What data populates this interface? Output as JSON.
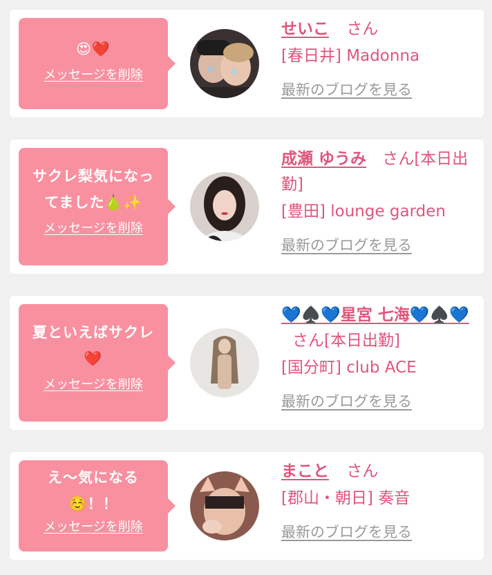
{
  "colors": {
    "background": "#f0f0f0",
    "card": "#ffffff",
    "bubble": "#f9909f",
    "accent": "#e0557a",
    "muted": "#999999"
  },
  "cards": [
    {
      "message": "😍❤️",
      "delete_label": "メッセージを削除",
      "avatar_icon": "profile-photo",
      "name": "せいこ",
      "suffix": "さん",
      "shop": "[春日井] Madonna",
      "blog_label": "最新のブログを見る"
    },
    {
      "message": "サクレ梨気になってました🍐✨",
      "delete_label": "メッセージを削除",
      "avatar_icon": "profile-photo",
      "name": "成瀬 ゆうみ",
      "suffix": "さん[本日出勤]",
      "shop": "[豊田] lounge garden",
      "blog_label": "最新のブログを見る"
    },
    {
      "message": "夏といえばサクレ❤️",
      "delete_label": "メッセージを削除",
      "avatar_icon": "profile-photo",
      "name": "💙♠️💙星宮 七海💙♠️💙",
      "suffix": "さん[本日出勤]",
      "shop": "[国分町] club ACE",
      "blog_label": "最新のブログを見る"
    },
    {
      "message": "え〜気になる☺️！！",
      "delete_label": "メッセージを削除",
      "avatar_icon": "profile-photo",
      "name": "まこと",
      "suffix": "さん",
      "shop": "[郡山・朝日] 奏音",
      "blog_label": "最新のブログを見る"
    }
  ]
}
